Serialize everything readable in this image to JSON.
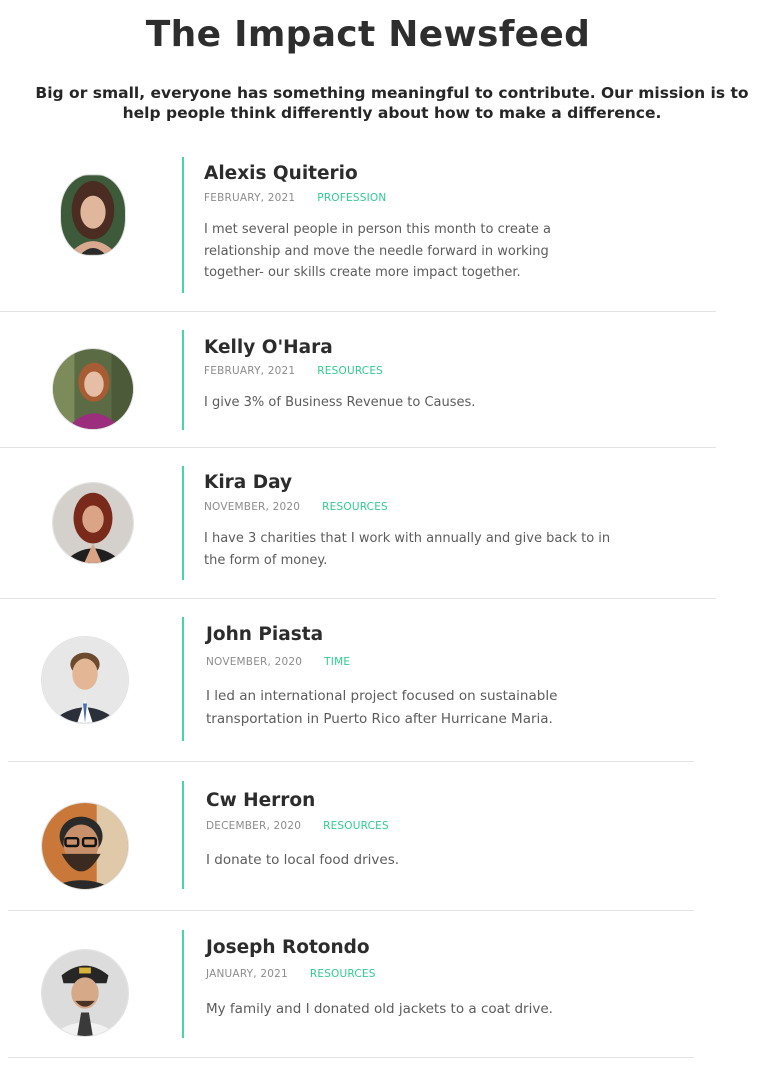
{
  "header": {
    "title": "The Impact Newsfeed",
    "subtitle": "Big or small, everyone has something meaningful to contribute. Our mission is to help people think differently about how to make a difference."
  },
  "accent_color": "#49d3a6",
  "category_color": "#2ecc8e",
  "entries": [
    {
      "name": "Alexis Quiterio",
      "date": "FEBRUARY, 2021",
      "category": "PROFESSION",
      "text": "I met several people in person this month to create a relationship and move the needle forward in working together- our skills create more impact together.",
      "avatar": "portrait-photo"
    },
    {
      "name": "Kelly O'Hara",
      "date": "FEBRUARY, 2021",
      "category": "RESOURCES",
      "text": "I give 3% of Business Revenue to Causes.",
      "avatar": "portrait-photo"
    },
    {
      "name": "Kira Day",
      "date": "NOVEMBER, 2020",
      "category": "RESOURCES",
      "text": "I have 3 charities that I work with annually and give back to in the form of money.",
      "avatar": "portrait-photo"
    },
    {
      "name": "John Piasta",
      "date": "NOVEMBER, 2020",
      "category": "TIME",
      "text": "I led an international project focused on sustainable transportation in Puerto Rico after Hurricane Maria.",
      "avatar": "portrait-photo"
    },
    {
      "name": "Cw Herron",
      "date": "DECEMBER, 2020",
      "category": "RESOURCES",
      "text": "I donate to local food drives.",
      "avatar": "portrait-photo"
    },
    {
      "name": "Joseph Rotondo",
      "date": "JANUARY, 2021",
      "category": "RESOURCES",
      "text": "My family and I donated old jackets to a coat drive.",
      "avatar": "portrait-photo"
    }
  ]
}
